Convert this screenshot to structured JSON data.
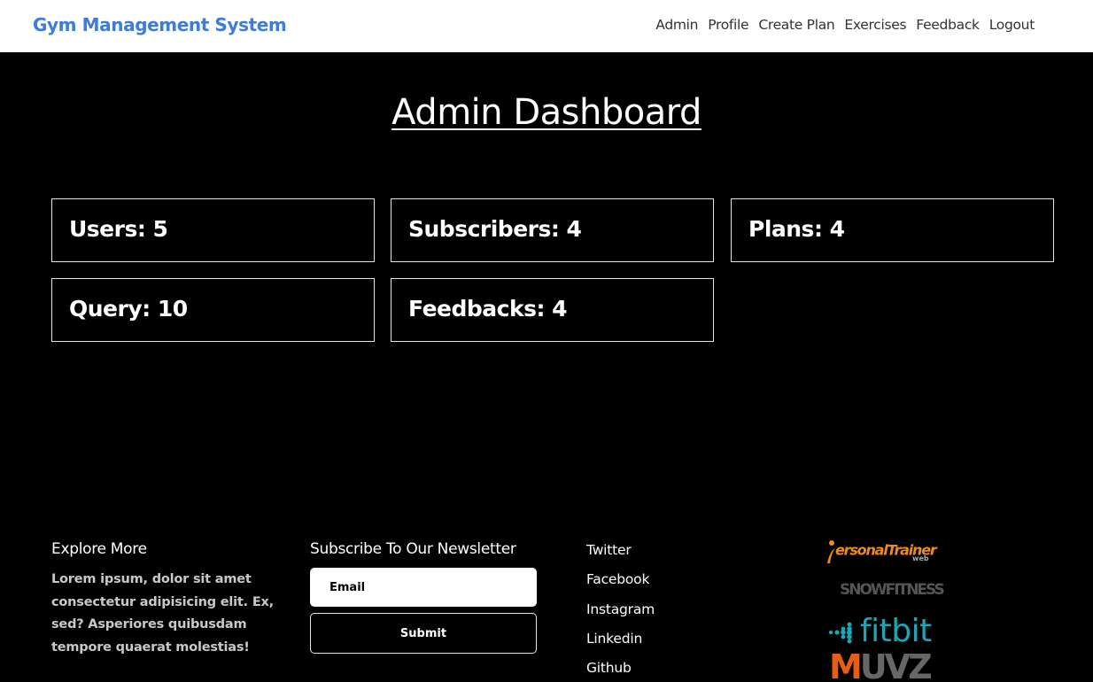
{
  "navbar": {
    "brand": "Gym Management System",
    "links": [
      "Admin",
      "Profile",
      "Create Plan",
      "Exercises",
      "Feedback",
      "Logout"
    ]
  },
  "page_title": "Admin Dashboard",
  "stats": [
    {
      "label": "Users: 5"
    },
    {
      "label": "Subscribers: 4"
    },
    {
      "label": "Plans: 4"
    },
    {
      "label": "Query: 10"
    },
    {
      "label": "Feedbacks: 4"
    }
  ],
  "footer": {
    "explore": {
      "heading": "Explore More",
      "text": "Lorem ipsum, dolor sit amet consectetur adipisicing elit. Ex, sed? Asperiores quibusdam tempore quaerat molestias!"
    },
    "newsletter": {
      "heading": "Subscribe To Our Newsletter",
      "email_placeholder": "Email",
      "submit_label": "Submit"
    },
    "social_links": [
      "Twitter",
      "Facebook",
      "Instagram",
      "Linkedin",
      "Github"
    ],
    "partner_logos": {
      "personal_trainer": "ersonalTrainer",
      "personal_trainer_sub": "web",
      "snow_fitness": "SNOWFITNESS",
      "fitbit": "fitbit",
      "muvz_m": "M",
      "muvz_rest": "UVZ"
    }
  },
  "colors": {
    "brand": "#3b7dd8",
    "background": "#000000",
    "navbar_bg": "#ffffff",
    "card_border": "#e6e6e6",
    "fitbit_teal": "#1ba5b5",
    "accent_orange": "#f08a1c"
  }
}
